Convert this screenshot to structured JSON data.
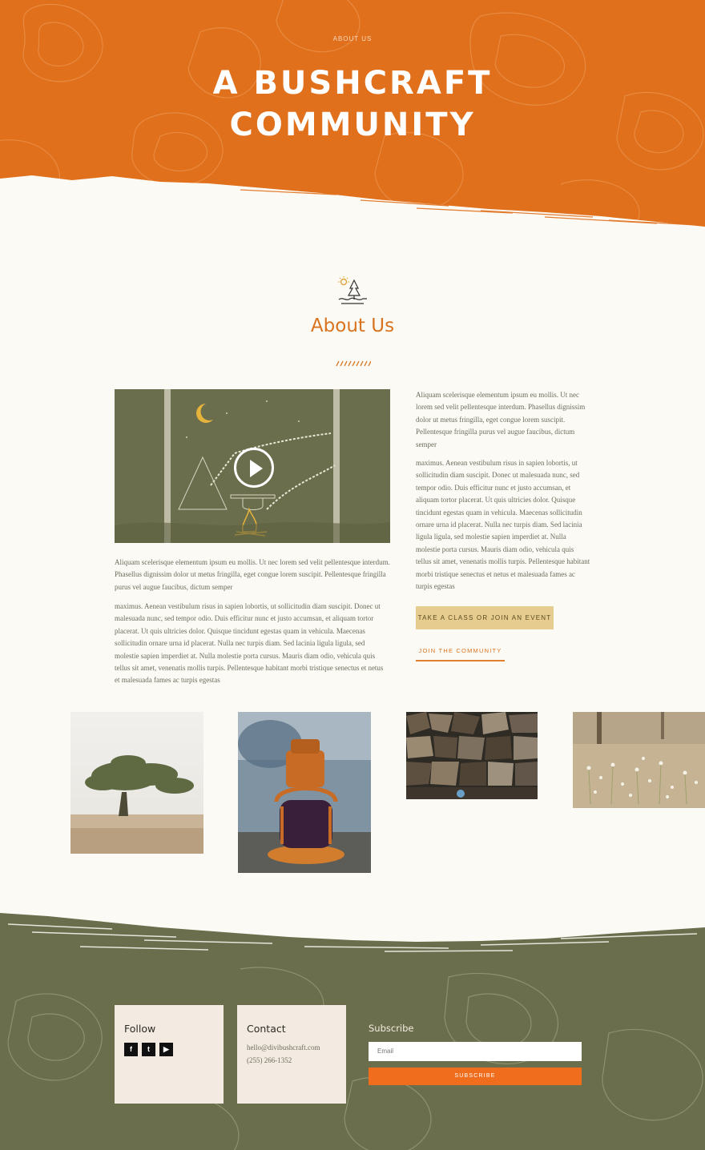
{
  "colors": {
    "brand_orange": "#e0701c",
    "olive": "#6b6e4c",
    "cream": "#fcfaf5",
    "button_sand": "#e6cd8f",
    "subscribe_orange": "#ef6d1c"
  },
  "hero": {
    "eyebrow": "ABOUT US",
    "title_line1": "A BUSHCRAFT",
    "title_line2": "COMMUNITY"
  },
  "about": {
    "icon": "campsite-icon",
    "title": "About Us",
    "video_play_icon": "play-icon",
    "left_paragraph_1": "Aliquam scelerisque elementum ipsum eu mollis. Ut nec lorem sed velit pellentesque interdum. Phasellus dignissim dolor ut metus fringilla, eget congue lorem suscipit. Pellentesque fringilla purus vel augue faucibus, dictum semper",
    "left_paragraph_2": "maximus. Aenean vestibulum risus in sapien lobortis, ut sollicitudin diam suscipit. Donec ut malesuada nunc, sed tempor odio. Duis efficitur nunc et justo accumsan, et aliquam tortor placerat. Ut quis ultricies dolor. Quisque tincidunt egestas quam in vehicula. Maecenas sollicitudin ornare urna id placerat. Nulla nec turpis diam. Sed lacinia ligula ligula, sed molestie sapien imperdiet at. Nulla molestie porta cursus. Mauris diam odio, vehicula quis tellus sit amet, venenatis mollis turpis. Pellentesque habitant morbi tristique senectus et netus et malesuada fames ac turpis egestas",
    "right_paragraph_1": "Aliquam scelerisque elementum ipsum eu mollis. Ut nec lorem sed velit pellentesque interdum. Phasellus dignissim dolor ut metus fringilla, eget congue lorem suscipit. Pellentesque fringilla purus vel augue faucibus, dictum semper",
    "right_paragraph_2": "maximus. Aenean vestibulum risus in sapien lobortis, ut sollicitudin diam suscipit. Donec ut malesuada nunc, sed tempor odio. Duis efficitur nunc et justo accumsan, et aliquam tortor placerat. Ut quis ultricies dolor. Quisque tincidunt egestas quam in vehicula. Maecenas sollicitudin ornare urna id placerat. Nulla nec turpis diam. Sed lacinia ligula ligula, sed molestie sapien imperdiet at. Nulla molestie porta cursus. Mauris diam odio, vehicula quis tellus sit amet, venenatis mollis turpis. Pellentesque habitant morbi tristique senectus et netus et malesuada fames ac turpis egestas",
    "primary_button": "TAKE A CLASS OR JOIN AN EVENT",
    "secondary_button": "JOIN THE COMMUNITY"
  },
  "gallery": [
    "tree-photo",
    "lantern-photo",
    "firewood-photo",
    "meadow-photo"
  ],
  "footer": {
    "follow_title": "Follow",
    "social": {
      "facebook": "f",
      "twitter": "t",
      "youtube": "▶"
    },
    "contact_title": "Contact",
    "email": "hello@divibushcraft.com",
    "phone": "(255) 266-1352",
    "subscribe_title": "Subscribe",
    "email_placeholder": "Email",
    "subscribe_button": "SUBSCRIBE"
  }
}
